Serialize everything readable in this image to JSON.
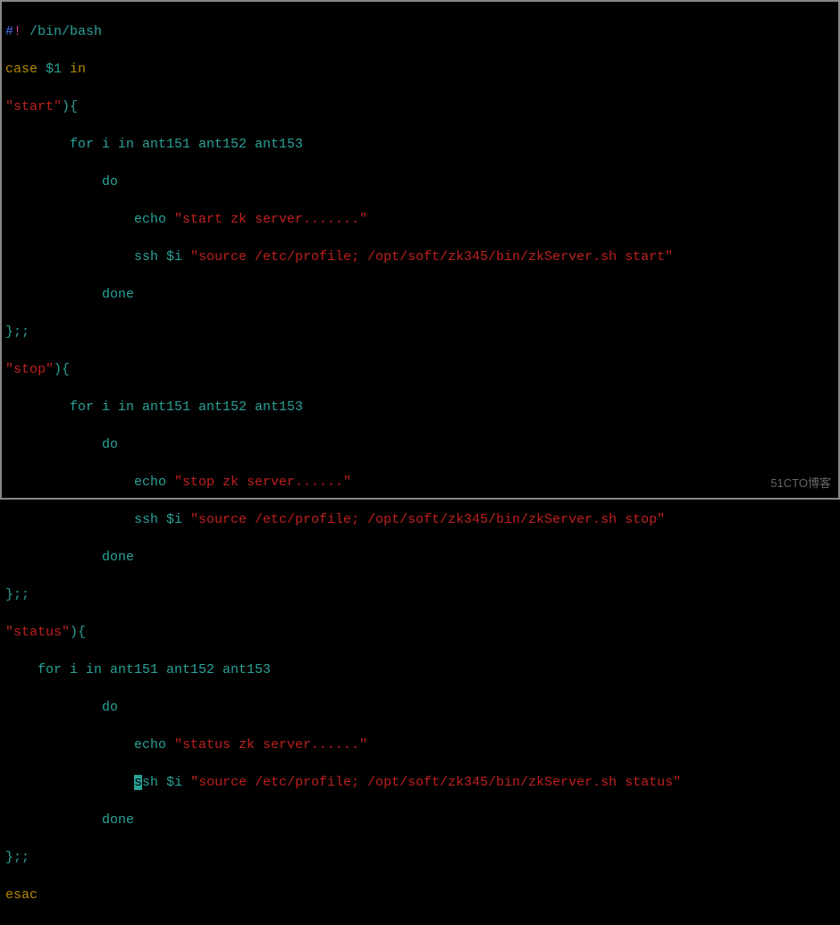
{
  "script": {
    "shebang_hash": "#",
    "shebang_bang": "!",
    "shebang_path": " /bin/bash",
    "case_kw": "case",
    "case_var": " $1 ",
    "in_kw": "in",
    "start_label": "\"start\"",
    "stop_label": "\"stop\"",
    "status_label": "\"status\"",
    "paren_brace": "){",
    "for_line": "        for i in ant151 ant152 ant153",
    "for_line_status": "    for i in ant151 ant152 ant153",
    "do_line": "            do",
    "echo_indent": "                echo ",
    "echo_start": "\"start zk server.......\"",
    "echo_stop": "\"stop zk server......\"",
    "echo_status": "\"status zk server......\"",
    "ssh_indent": "                ssh ",
    "ssh_indent_cursor_pre": "                ",
    "cursor_char": "s",
    "ssh_after_cursor": "sh ",
    "ssh_var": "$i ",
    "cmd_start": "\"source /etc/profile; /opt/soft/zk345/bin/zkServer.sh start\"",
    "cmd_stop": "\"source /etc/profile; /opt/soft/zk345/bin/zkServer.sh stop\"",
    "cmd_status": "\"source /etc/profile; /opt/soft/zk345/bin/zkServer.sh status\"",
    "done_line": "            done",
    "brace_semi": "};;",
    "esac_kw": "esac"
  },
  "watermark": "51CTO博客"
}
